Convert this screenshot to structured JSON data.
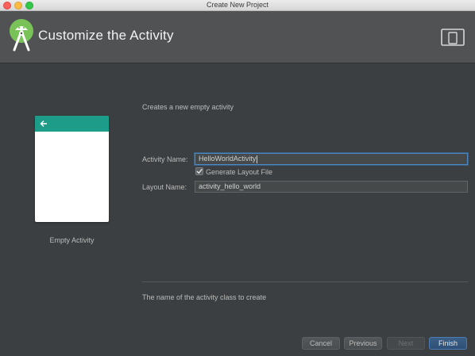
{
  "window": {
    "title": "Create New Project"
  },
  "header": {
    "title": "Customize the Activity",
    "logo_icon": "android-studio-icon",
    "device_icon": "tablet-phone-icon"
  },
  "preview": {
    "caption": "Empty Activity"
  },
  "form": {
    "description": "Creates a new empty activity",
    "activity_name_label": "Activity Name:",
    "activity_name_value": "HelloWorldActivity",
    "generate_layout_label": "Generate Layout File",
    "generate_layout_checked": true,
    "layout_name_label": "Layout Name:",
    "layout_name_value": "activity_hello_world"
  },
  "hint": "The name of the activity class to create",
  "buttons": {
    "cancel": "Cancel",
    "previous": "Previous",
    "next": "Next",
    "finish": "Finish"
  },
  "colors": {
    "accent": "#1e9c8a",
    "focus": "#4a88c7",
    "background": "#3c3f41"
  }
}
